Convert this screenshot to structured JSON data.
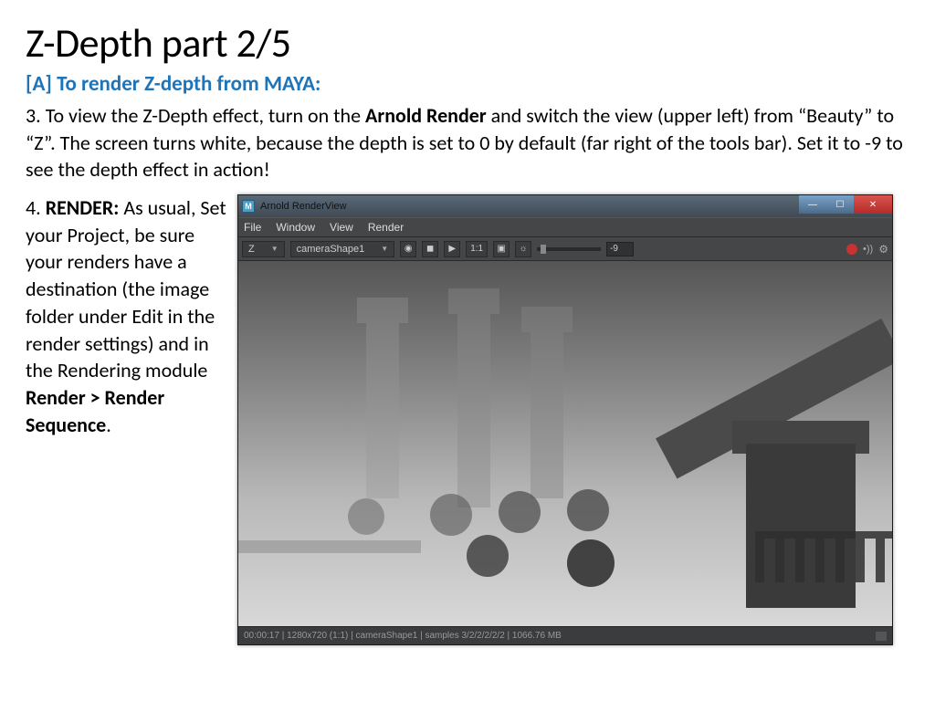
{
  "title": "Z-Depth part 2/5",
  "subhead": "[A] To render Z-depth from MAYA:",
  "step3": {
    "num": "3. ",
    "pre": "To view the Z-Depth effect, turn on the ",
    "bold1": "Arnold Render",
    "post": " and switch the view (upper left) from “Beauty” to “Z”. The screen turns white, because the depth is set to 0 by default (far right of the tools bar). Set it to -9 to see the depth effect in action!"
  },
  "step4": {
    "num": "4. ",
    "bold1": "RENDER:",
    "mid": " As usual, Set your Project, be sure your renders have a destination (the image folder under Edit in the render settings) and in the Rendering module ",
    "bold2": "Render > Render Sequence",
    "end": "."
  },
  "arv": {
    "app_icon": "M",
    "window_title": "Arnold RenderView",
    "menu": {
      "file": "File",
      "window": "Window",
      "view": "View",
      "render": "Render"
    },
    "channel": "Z",
    "camera": "cameraShape1",
    "ratio_label": "1:1",
    "depth_value": "-9",
    "status": "00:00:17 | 1280x720 (1:1) | cameraShape1  | samples 3/2/2/2/2/2 | 1066.76 MB"
  }
}
